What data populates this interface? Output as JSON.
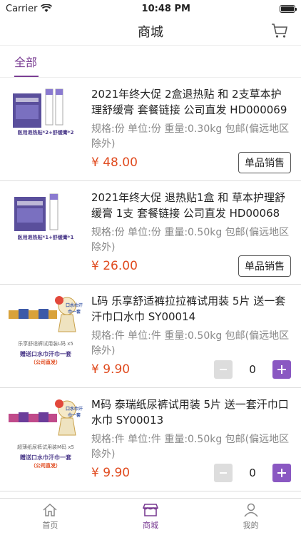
{
  "status": {
    "carrier": "Carrier",
    "time": "10:48 PM"
  },
  "header": {
    "title": "商城",
    "cart_icon": "cart-icon"
  },
  "tabs": [
    {
      "label": "全部"
    }
  ],
  "products": [
    {
      "name": "2021年终大促 2盒退热贴 和 2支草本护理舒缓膏 套餐链接 公司直发 HD000069",
      "spec": "规格:份 单位:份 重量:0.30kg 包邮(偏远地区除外)",
      "price": "¥ 48.00",
      "action": "单品销售",
      "image_caption": "医用退热贴*2+舒缓膏*2"
    },
    {
      "name": "2021年终大促 退热贴1盒 和 草本护理舒缓膏 1支  套餐链接 公司直发 HD00068",
      "spec": "规格:份 单位:份 重量:0.50kg 包邮(偏远地区除外)",
      "price": "¥ 26.00",
      "action": "单品销售",
      "image_caption": "医用退热贴*1+舒缓膏*1"
    },
    {
      "name": "L码 乐享舒适裤拉拉裤试用装 5片 送一套汗巾口水巾 SY00014",
      "spec": "规格:件 单位:件 重量:0.50kg 包邮(偏远地区除外)",
      "price": "¥ 9.90",
      "qty": "0",
      "image_caption": "乐享舒适裤试用装L码 x5",
      "image_caption2": "赠送口水巾汗巾一套",
      "image_caption3": "（公司直发）",
      "bubble_text": "口水巾汗巾一套"
    },
    {
      "name": "M码  泰瑞纸尿裤试用装  5片 送一套汗巾口水巾 SY00013",
      "spec": "规格:件 单位:件 重量:0.50kg 包邮(偏远地区除外)",
      "price": "¥ 9.90",
      "qty": "0",
      "image_caption": "超薄纸尿裤试用装M码 x5",
      "image_caption2": "赠送口水巾汗巾一套",
      "image_caption3": "（公司直发）",
      "bubble_text": "口水巾汗巾一套"
    }
  ],
  "tabbar": [
    {
      "label": "首页",
      "icon": "home-icon"
    },
    {
      "label": "商城",
      "icon": "store-icon",
      "active": true
    },
    {
      "label": "我的",
      "icon": "user-icon"
    }
  ],
  "colors": {
    "accent": "#7a3d93",
    "price": "#e04a1e",
    "plus": "#8a58c2"
  }
}
